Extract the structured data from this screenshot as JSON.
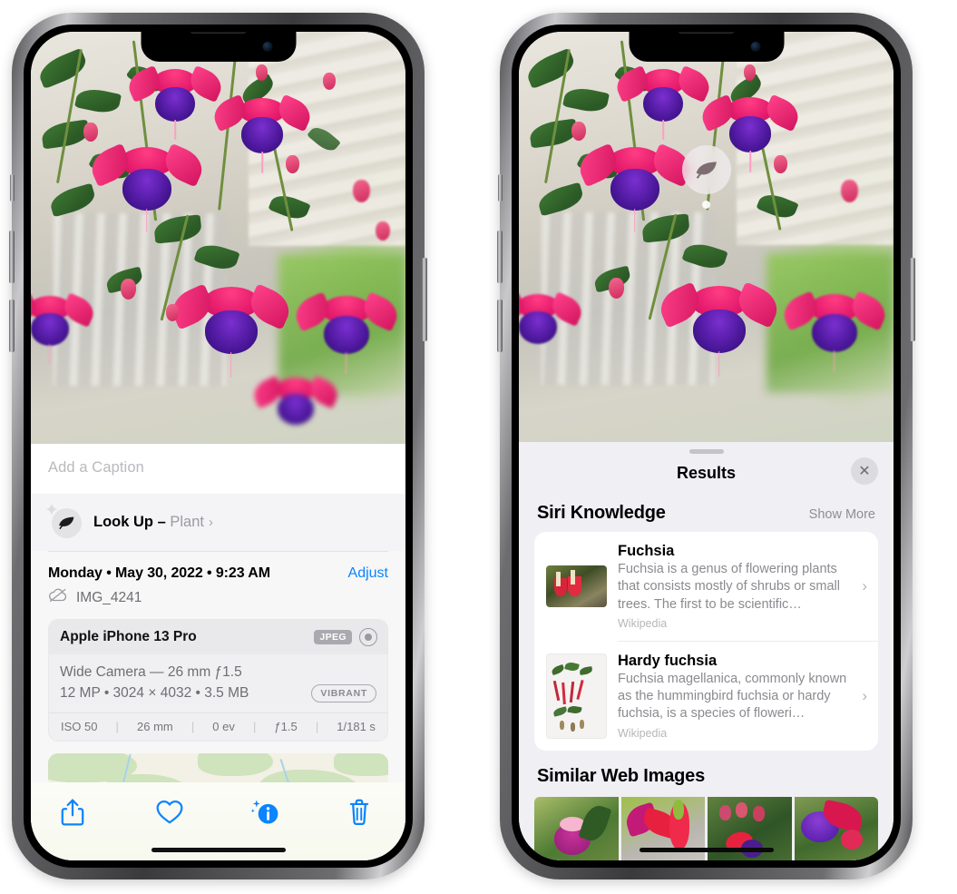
{
  "left_phone": {
    "caption_placeholder": "Add a Caption",
    "lookup": {
      "label": "Look Up – ",
      "subject": "Plant",
      "chevron": "›",
      "icon": "leaf-icon",
      "sparkle": "✦"
    },
    "datetime": "Monday • May 30, 2022 • 9:23 AM",
    "adjust_label": "Adjust",
    "filename": "IMG_4241",
    "cloud_icon": "icloud-slash-icon",
    "metadata": {
      "device": "Apple iPhone 13 Pro",
      "format_badge": "JPEG",
      "aperture_icon": "aperture-icon",
      "lens_line": "Wide Camera — 26 mm ƒ1.5",
      "specs_line": "12 MP • 3024 × 4032 • 3.5 MB",
      "style_badge": "VIBRANT",
      "exif": [
        "ISO 50",
        "26 mm",
        "0 ev",
        "ƒ1.5",
        "1/181 s"
      ],
      "exif_separator": "|"
    },
    "toolbar": [
      {
        "name": "share-button",
        "icon": "share-icon"
      },
      {
        "name": "favorite-button",
        "icon": "heart-icon"
      },
      {
        "name": "info-button",
        "icon": "info-sparkle-icon"
      },
      {
        "name": "delete-button",
        "icon": "trash-icon"
      }
    ],
    "accent_color": "#0a84ff"
  },
  "right_phone": {
    "visual_lookup_badge": {
      "icon": "leaf-icon"
    },
    "results_title": "Results",
    "close_icon": "close-icon",
    "siri_knowledge": {
      "title": "Siri Knowledge",
      "show_more": "Show More",
      "cards": [
        {
          "title": "Fuchsia",
          "description": "Fuchsia is a genus of flowering plants that consists mostly of shrubs or small trees. The first to be scientific…",
          "source": "Wikipedia",
          "chevron": "›"
        },
        {
          "title": "Hardy fuchsia",
          "description": "Fuchsia magellanica, commonly known as the hummingbird fuchsia or hardy fuchsia, is a species of floweri…",
          "source": "Wikipedia",
          "chevron": "›"
        }
      ]
    },
    "similar_web_images": {
      "title": "Similar Web Images",
      "count": 4
    }
  }
}
